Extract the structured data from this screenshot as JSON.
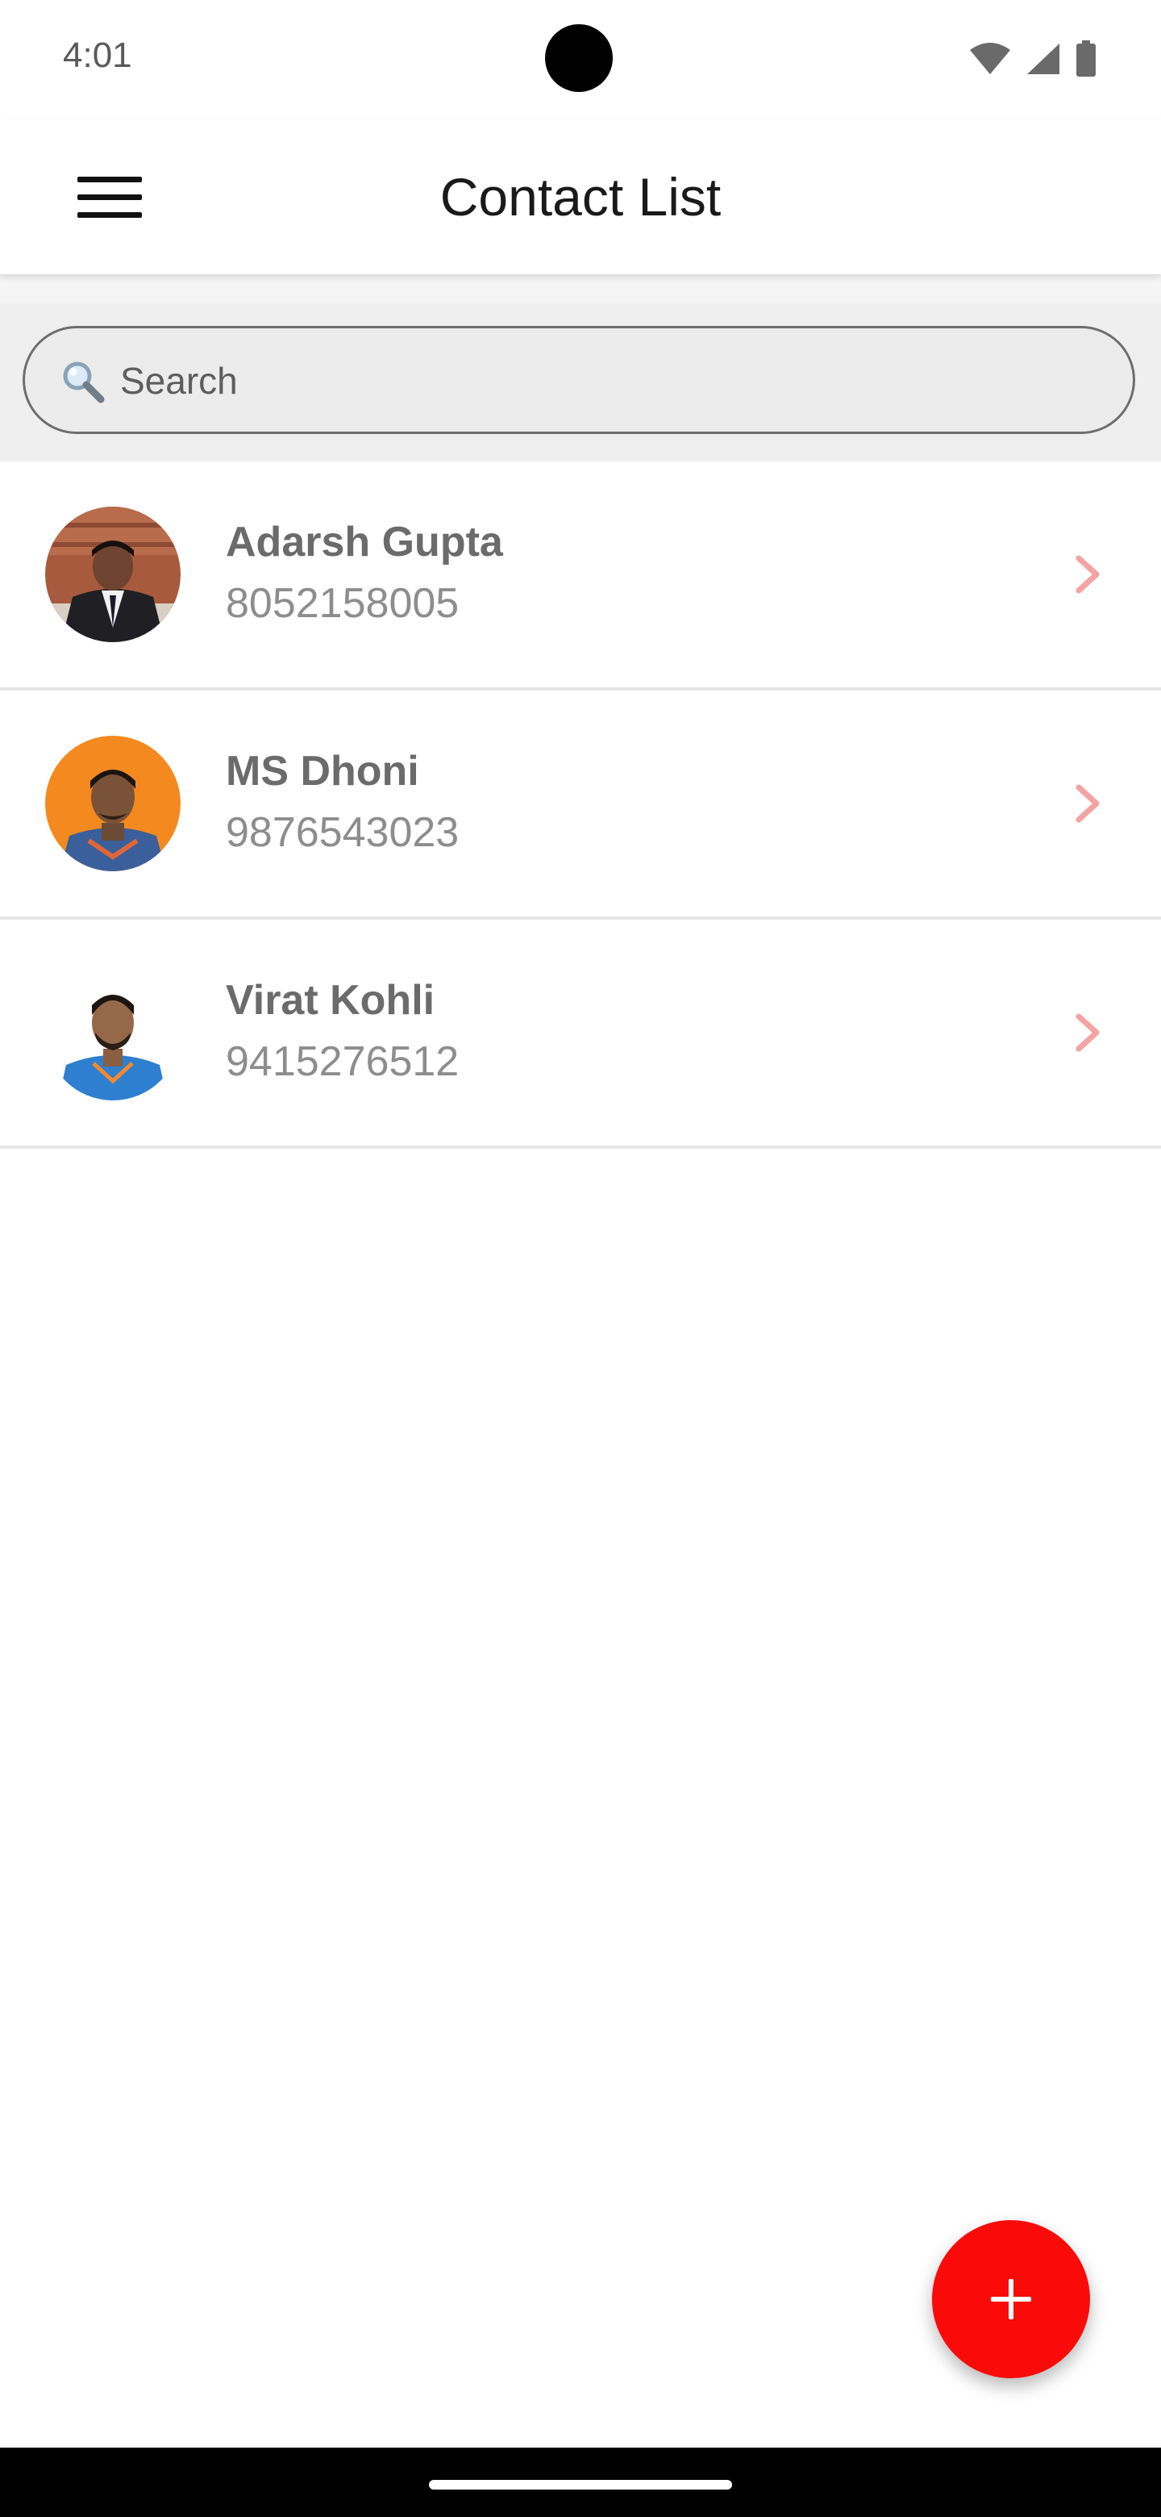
{
  "status_bar": {
    "time": "4:01",
    "icons": [
      "wifi-icon",
      "signal-icon",
      "battery-icon"
    ]
  },
  "app_bar": {
    "title": "Contact List",
    "menu_icon": "hamburger-menu-icon"
  },
  "search": {
    "placeholder": "Search",
    "value": "",
    "icon": "search-icon"
  },
  "contacts": [
    {
      "name": "Adarsh Gupta",
      "phone": "8052158005",
      "avatar": "contact-photo"
    },
    {
      "name": "MS Dhoni",
      "phone": "9876543023",
      "avatar": "contact-photo"
    },
    {
      "name": "Virat Kohli",
      "phone": "9415276512",
      "avatar": "contact-photo"
    }
  ],
  "fab": {
    "icon": "plus-icon",
    "color": "#fb0a0a"
  },
  "colors": {
    "accent": "#fb0a0a",
    "chevron": "#f4a3a3",
    "name_text": "#6b6b6b",
    "phone_text": "#8d8d8d",
    "divider": "#e6e6e6"
  }
}
